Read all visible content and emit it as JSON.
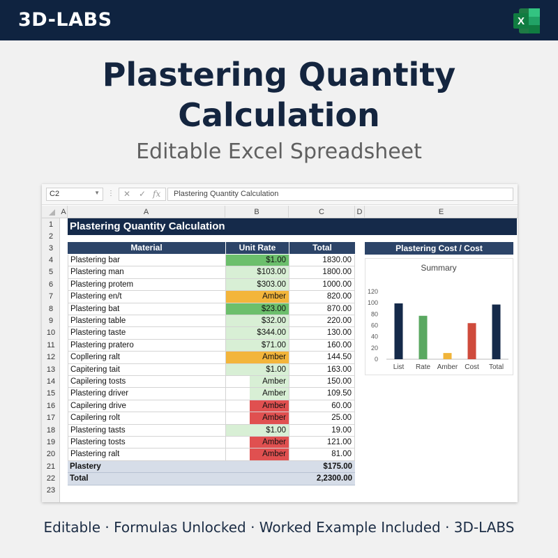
{
  "brand": "3D-LABS",
  "title_line1": "Plastering Quantity",
  "title_line2": "Calculation",
  "subtitle": "Editable Excel Spreadsheet",
  "footer": "Editable · Formulas Unlocked · Worked Example Included · 3D-LABS",
  "excel_icon": "excel-icon",
  "sheet": {
    "name_box": "C2",
    "formula": "Plastering Quantity Calculation",
    "columns": [
      "A",
      "A",
      "B",
      "C",
      "D",
      "E"
    ],
    "rows": [
      "1",
      "2",
      "3",
      "4",
      "5",
      "6",
      "7",
      "8",
      "9",
      "10",
      "11",
      "12",
      "13",
      "14",
      "15",
      "16",
      "17",
      "18",
      "19",
      "20",
      "21",
      "22",
      "23"
    ],
    "banner": "Plastering Quantity Calculation",
    "headers": {
      "material": "Material",
      "rate": "Unit Rate",
      "total": "Total"
    },
    "items": [
      {
        "material": "Plastering bar",
        "rate": "$1.00",
        "total": "1830.00",
        "fill": "#6cbf6c"
      },
      {
        "material": "Plastering man",
        "rate": "$103.00",
        "total": "1800.00",
        "fill": "#d8efd5"
      },
      {
        "material": "Plastering protem",
        "rate": "$303.00",
        "total": "1000.00",
        "fill": "#d8efd5"
      },
      {
        "material": "Plastering en/t",
        "rate": "Amber",
        "total": "820.00",
        "fill": "#f3b53b"
      },
      {
        "material": "Plastering bat",
        "rate": "$23.00",
        "total": "870.00",
        "fill": "#6cbf6c"
      },
      {
        "material": "Plastering table",
        "rate": "$32.00",
        "total": "220.00",
        "fill": "#d8efd5"
      },
      {
        "material": "Plastering taste",
        "rate": "$344.00",
        "total": "130.00",
        "fill": "#d8efd5"
      },
      {
        "material": "Plastering pratero",
        "rate": "$71.00",
        "total": "160.00",
        "fill": "#d8efd5"
      },
      {
        "material": "Copllering ralt",
        "rate": "Amber",
        "total": "144.50",
        "fill": "#f3b53b"
      },
      {
        "material": "Capitering tait",
        "rate": "$1.00",
        "total": "163.00",
        "fill": "#d8efd5"
      },
      {
        "material": "Capilering tosts",
        "rate": "Amber",
        "total": "150.00",
        "fill": "#d8efd5"
      },
      {
        "material": "Plastering driver",
        "rate": "Amber",
        "total": "109.50",
        "fill": "#d8efd5"
      },
      {
        "material": "Capilering drive",
        "rate": "Amber",
        "total": "60.00",
        "fill": "#e05050"
      },
      {
        "material": "Capilering rolt",
        "rate": "Amber",
        "total": "25.00",
        "fill": "#e05050"
      },
      {
        "material": "Plastering tasts",
        "rate": "$1.00",
        "total": "19.00",
        "fill": "#d8efd5"
      },
      {
        "material": "Plastering tosts",
        "rate": "Amber",
        "total": "121.00",
        "fill": "#e05050"
      },
      {
        "material": "Plastering ralt",
        "rate": "Amber",
        "total": "81.00",
        "fill": "#e05050"
      }
    ],
    "footer_rows": [
      {
        "label": "Plastery",
        "value": "$175.00"
      },
      {
        "label": "Total",
        "value": "2,2300.00"
      }
    ]
  },
  "chart_header": "Plastering Cost / Cost",
  "chart_data": {
    "type": "bar",
    "title": "Summary",
    "categories": [
      "List",
      "Rate",
      "Amber",
      "Cost",
      "Total"
    ],
    "values": [
      99,
      77,
      11,
      64,
      97
    ],
    "colors": [
      "#152a4a",
      "#5aa861",
      "#f0b43a",
      "#cf4b3c",
      "#152a4a"
    ],
    "ylim": [
      0,
      120
    ],
    "yticks": [
      0,
      20,
      40,
      60,
      80,
      100,
      120
    ]
  }
}
